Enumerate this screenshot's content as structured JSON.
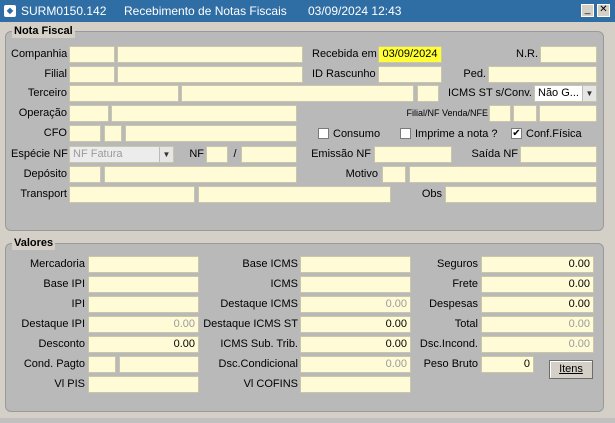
{
  "window": {
    "code": "SURM0150.142",
    "title": "Recebimento de Notas Fiscais",
    "datetime": "03/09/2024 12:43",
    "minimize_icon": "minimize-icon",
    "close_icon": "close-icon"
  },
  "nota_fiscal": {
    "section_title": "Nota Fiscal",
    "companhia": {
      "label": "Companhia",
      "code": "",
      "name": ""
    },
    "recebida_em": {
      "label": "Recebida em",
      "value": "03/09/2024"
    },
    "nr": {
      "label": "N.R.",
      "value": ""
    },
    "filial": {
      "label": "Filial",
      "code": "",
      "name": ""
    },
    "id_rascunho": {
      "label": "ID Rascunho",
      "value": ""
    },
    "ped": {
      "label": "Ped.",
      "value": ""
    },
    "terceiro": {
      "label": "Terceiro",
      "code": "",
      "name": "",
      "extra": ""
    },
    "icms_st": {
      "label": "ICMS ST s/Conv.",
      "value": "Não G..."
    },
    "operacao": {
      "label": "Operação",
      "code": "",
      "name": ""
    },
    "filial_nf_venda": {
      "label": "Filial/NF Venda/NFE",
      "v1": "",
      "v2": "",
      "v3": ""
    },
    "cfo": {
      "label": "CFO",
      "code": "",
      "sub": "",
      "name": ""
    },
    "consumo": {
      "label": "Consumo",
      "checked": false
    },
    "imprime_nota": {
      "label": "Imprime a nota ?",
      "checked": false
    },
    "conf_fisica": {
      "label": "Conf.Física",
      "checked": true,
      "mark": "✔"
    },
    "especie_nf": {
      "label": "Espécie NF",
      "value": "NF Fatura"
    },
    "nf": {
      "label": "NF",
      "serie": "",
      "sep": "/",
      "numero": ""
    },
    "emissao_nf": {
      "label": "Emissão NF",
      "value": ""
    },
    "saida_nf": {
      "label": "Saída NF",
      "value": ""
    },
    "deposito": {
      "label": "Depósito",
      "code": "",
      "name": ""
    },
    "motivo": {
      "label": "Motivo",
      "code": "",
      "name": ""
    },
    "transport": {
      "label": "Transport",
      "code": "",
      "name": ""
    },
    "obs": {
      "label": "Obs",
      "value": ""
    }
  },
  "valores": {
    "section_title": "Valores",
    "mercadoria": {
      "label": "Mercadoria",
      "value": ""
    },
    "base_ipi": {
      "label": "Base IPI",
      "value": ""
    },
    "ipi": {
      "label": "IPI",
      "value": ""
    },
    "destaque_ipi": {
      "label": "Destaque IPI",
      "value": "0.00"
    },
    "desconto": {
      "label": "Desconto",
      "value": "0.00"
    },
    "cond_pagto": {
      "label": "Cond. Pagto",
      "code": "",
      "name": ""
    },
    "vl_pis": {
      "label": "Vl PIS",
      "value": ""
    },
    "base_icms": {
      "label": "Base ICMS",
      "value": ""
    },
    "icms": {
      "label": "ICMS",
      "value": ""
    },
    "destaque_icms": {
      "label": "Destaque ICMS",
      "value": "0.00"
    },
    "destaque_icms_st": {
      "label": "Destaque ICMS ST",
      "value": "0.00"
    },
    "icms_sub_trib": {
      "label": "ICMS Sub. Trib.",
      "value": "0.00"
    },
    "dsc_condicional": {
      "label": "Dsc.Condicional",
      "value": "0.00"
    },
    "vl_cofins": {
      "label": "Vl COFINS",
      "value": ""
    },
    "seguros": {
      "label": "Seguros",
      "value": "0.00"
    },
    "frete": {
      "label": "Frete",
      "value": "0.00"
    },
    "despesas": {
      "label": "Despesas",
      "value": "0.00"
    },
    "total": {
      "label": "Total",
      "value": "0.00"
    },
    "dsc_incond": {
      "label": "Dsc.Incond.",
      "value": "0.00"
    },
    "peso_bruto": {
      "label": "Peso Bruto",
      "value": "0"
    },
    "itens_button": "Itens"
  },
  "colors": {
    "titlebar": "#2f6ea5",
    "field": "#fffbd6",
    "highlight": "#ffff33",
    "panel": "#b9b9b9"
  }
}
